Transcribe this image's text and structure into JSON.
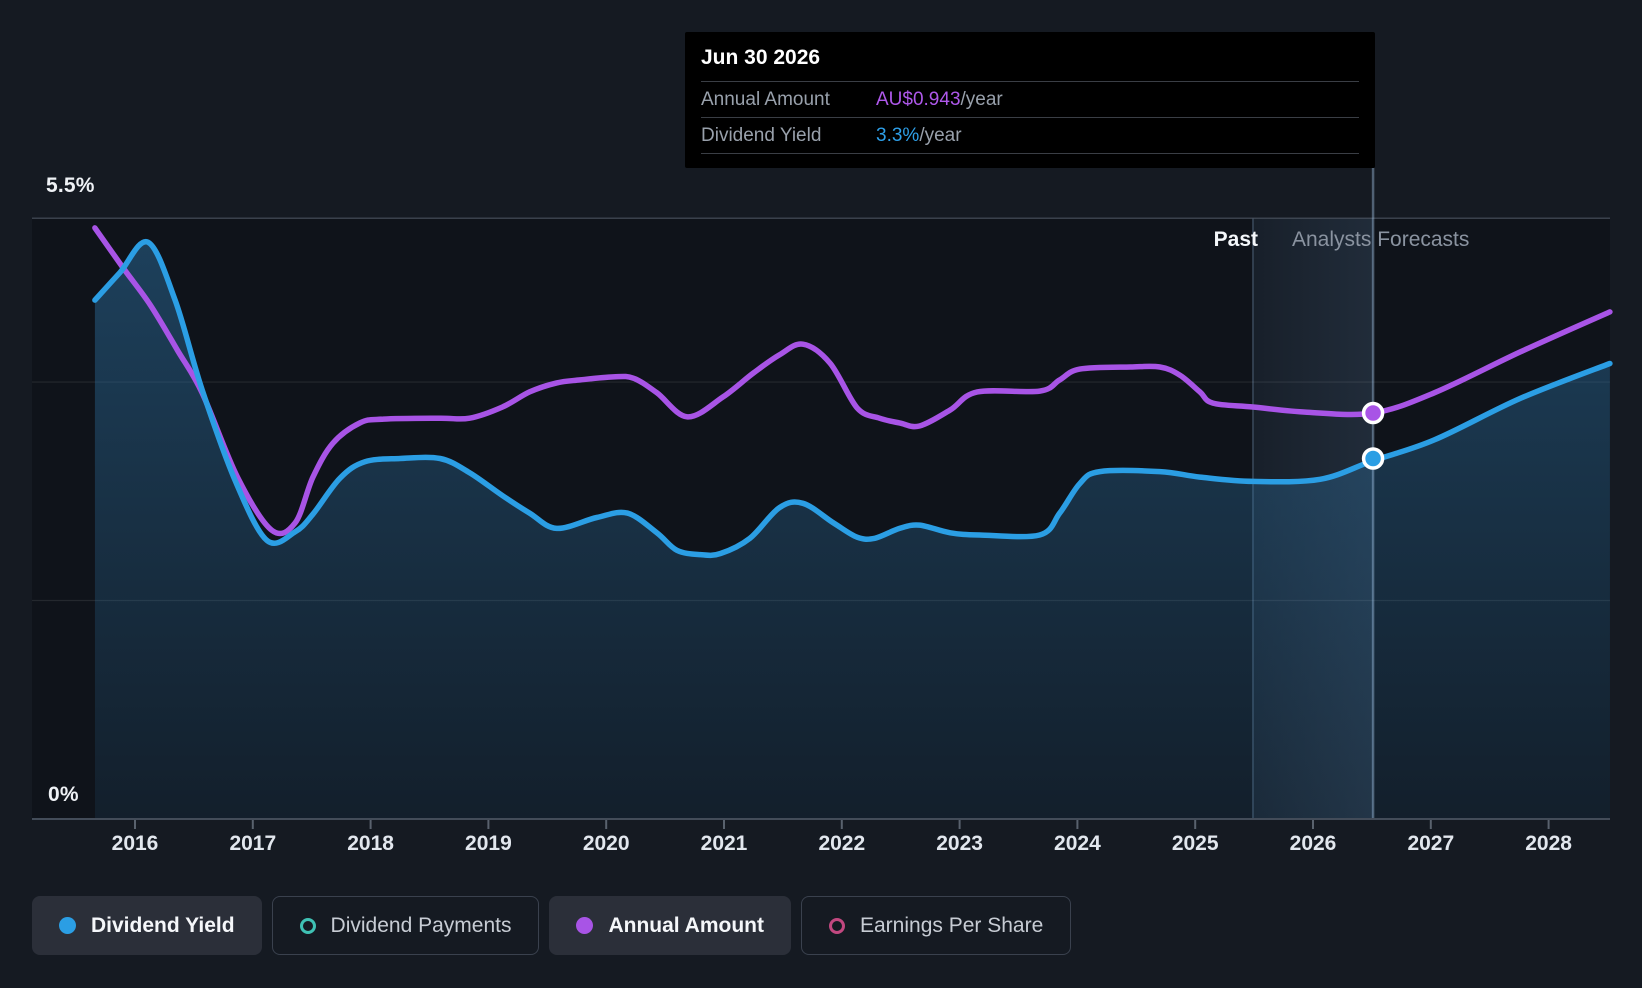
{
  "tooltip": {
    "date": "Jun 30 2026",
    "rows": [
      {
        "label": "Annual Amount",
        "value": "AU$0.943",
        "suffix": "/year",
        "color": "#AE58EA",
        "slug": "annual-amount"
      },
      {
        "label": "Dividend Yield",
        "value": "3.3%",
        "suffix": "/year",
        "color": "#2E9FE8",
        "slug": "dividend-yield"
      }
    ]
  },
  "axis": {
    "y_max_label": "5.5%",
    "y_min_label": "0%",
    "years": [
      "2016",
      "2017",
      "2018",
      "2019",
      "2020",
      "2021",
      "2022",
      "2023",
      "2024",
      "2025",
      "2026",
      "2027",
      "2028"
    ]
  },
  "annotations": {
    "past": "Past",
    "forecast": "Analysts Forecasts"
  },
  "legend": [
    {
      "label": "Dividend Yield",
      "slug": "dividend-yield",
      "style": "filled",
      "marker": "dot",
      "color": "#2B9EE4"
    },
    {
      "label": "Dividend Payments",
      "slug": "dividend-payments",
      "style": "outline",
      "marker": "ring",
      "color": "#3FC1B4"
    },
    {
      "label": "Annual Amount",
      "slug": "annual-amount",
      "style": "filled",
      "marker": "dot",
      "color": "#A854E6"
    },
    {
      "label": "Earnings Per Share",
      "slug": "earnings-per-share",
      "style": "outline",
      "marker": "ring",
      "color": "#C24880"
    }
  ],
  "chart_data": {
    "type": "line",
    "title": "Dividend yield history and forecast",
    "xlim": [
      2015.13,
      2028.52
    ],
    "x_ticks": [
      2016,
      2017,
      2018,
      2019,
      2020,
      2021,
      2022,
      2023,
      2024,
      2025,
      2026,
      2027,
      2028
    ],
    "grid_on": true,
    "y_axis_percent": {
      "min": 0,
      "max_gridline": 5.5,
      "gridlines_pct": [
        5.5,
        4.0,
        2.0,
        0.0
      ]
    },
    "past_end_year": 2025.49,
    "hover_year": 2026.51,
    "colors": {
      "dividend_yield": "#2B9EE4",
      "annual_amount": "#A854E6",
      "area_fill": "#2E77AB",
      "plot_bg": "#0F131A",
      "page_bg": "#151A22",
      "band": "#7DAFE1"
    },
    "series": [
      {
        "name": "Dividend Yield",
        "unit": "percent",
        "axis": "y",
        "color": "#2B9EE4",
        "area": true,
        "points": [
          [
            2015.66,
            4.75
          ],
          [
            2015.87,
            5.0
          ],
          [
            2016.11,
            5.28
          ],
          [
            2016.34,
            4.75
          ],
          [
            2016.57,
            3.93
          ],
          [
            2016.85,
            3.1
          ],
          [
            2017.12,
            2.55
          ],
          [
            2017.36,
            2.63
          ],
          [
            2017.51,
            2.79
          ],
          [
            2017.74,
            3.12
          ],
          [
            2017.95,
            3.27
          ],
          [
            2018.25,
            3.3
          ],
          [
            2018.59,
            3.3
          ],
          [
            2018.84,
            3.17
          ],
          [
            2019.12,
            2.96
          ],
          [
            2019.35,
            2.8
          ],
          [
            2019.58,
            2.66
          ],
          [
            2019.92,
            2.76
          ],
          [
            2020.18,
            2.8
          ],
          [
            2020.43,
            2.62
          ],
          [
            2020.6,
            2.46
          ],
          [
            2020.8,
            2.42
          ],
          [
            2020.97,
            2.43
          ],
          [
            2021.22,
            2.57
          ],
          [
            2021.47,
            2.85
          ],
          [
            2021.67,
            2.89
          ],
          [
            2021.93,
            2.71
          ],
          [
            2022.13,
            2.58
          ],
          [
            2022.28,
            2.57
          ],
          [
            2022.49,
            2.66
          ],
          [
            2022.66,
            2.69
          ],
          [
            2022.92,
            2.62
          ],
          [
            2023.17,
            2.6
          ],
          [
            2023.68,
            2.6
          ],
          [
            2023.85,
            2.8
          ],
          [
            2024.02,
            3.07
          ],
          [
            2024.19,
            3.18
          ],
          [
            2024.7,
            3.18
          ],
          [
            2025.04,
            3.13
          ],
          [
            2025.49,
            3.09
          ],
          [
            2026.06,
            3.11
          ],
          [
            2026.51,
            3.28
          ],
          [
            2027.03,
            3.47
          ],
          [
            2027.76,
            3.85
          ],
          [
            2028.52,
            4.17
          ]
        ]
      },
      {
        "name": "Annual Amount",
        "unit": "AU$ per year",
        "axis": "y2",
        "color": "#A854E6",
        "area": false,
        "points": [
          [
            2015.66,
            1.373
          ],
          [
            2015.9,
            1.28
          ],
          [
            2016.13,
            1.194
          ],
          [
            2016.36,
            1.089
          ],
          [
            2016.57,
            0.99
          ],
          [
            2016.87,
            0.794
          ],
          [
            2017.16,
            0.671
          ],
          [
            2017.36,
            0.688
          ],
          [
            2017.51,
            0.794
          ],
          [
            2017.68,
            0.873
          ],
          [
            2017.91,
            0.92
          ],
          [
            2018.11,
            0.929
          ],
          [
            2018.59,
            0.931
          ],
          [
            2018.84,
            0.931
          ],
          [
            2019.12,
            0.957
          ],
          [
            2019.35,
            0.992
          ],
          [
            2019.58,
            1.013
          ],
          [
            2019.78,
            1.02
          ],
          [
            2020.06,
            1.027
          ],
          [
            2020.23,
            1.024
          ],
          [
            2020.43,
            0.99
          ],
          [
            2020.69,
            0.934
          ],
          [
            2020.99,
            0.98
          ],
          [
            2021.25,
            1.036
          ],
          [
            2021.47,
            1.078
          ],
          [
            2021.67,
            1.103
          ],
          [
            2021.9,
            1.059
          ],
          [
            2022.13,
            0.955
          ],
          [
            2022.32,
            0.931
          ],
          [
            2022.49,
            0.92
          ],
          [
            2022.66,
            0.913
          ],
          [
            2022.92,
            0.95
          ],
          [
            2023.15,
            0.992
          ],
          [
            2023.68,
            0.994
          ],
          [
            2023.85,
            1.02
          ],
          [
            2024.02,
            1.045
          ],
          [
            2024.45,
            1.05
          ],
          [
            2024.7,
            1.05
          ],
          [
            2024.87,
            1.031
          ],
          [
            2025.04,
            0.992
          ],
          [
            2025.15,
            0.966
          ],
          [
            2025.49,
            0.957
          ],
          [
            2025.95,
            0.945
          ],
          [
            2026.51,
            0.943
          ],
          [
            2027.03,
            0.99
          ],
          [
            2027.76,
            1.085
          ],
          [
            2028.52,
            1.178
          ]
        ]
      }
    ],
    "hover_markers": [
      {
        "series": "Annual Amount",
        "x": 2026.51,
        "value": 0.943,
        "display": "AU$0.943/year"
      },
      {
        "series": "Dividend Yield",
        "x": 2026.51,
        "value": 3.3,
        "display": "3.3%/year"
      }
    ]
  }
}
